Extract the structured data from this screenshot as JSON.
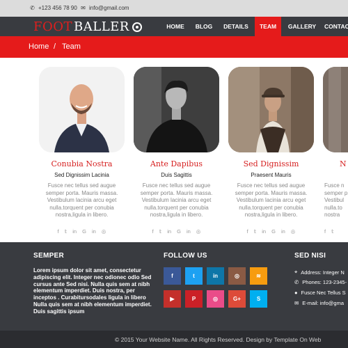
{
  "topbar": {
    "phone_icon": "phone-icon",
    "phone": "+123 456 78 90",
    "email_icon": "envelope-icon",
    "email": "info@gmail.com"
  },
  "logo": {
    "part1": "FOOT",
    "part2": "BALLER",
    "icon": "soccer-ball-icon"
  },
  "nav": {
    "items": [
      "HOME",
      "BLOG",
      "DETAILS",
      "TEAM",
      "GALLERY",
      "CONTACT"
    ],
    "active": "TEAM"
  },
  "breadcrumb": {
    "home": "Home",
    "separator": "/",
    "current": "Team"
  },
  "team": [
    {
      "name": "Conubia Nostra",
      "role": "Sed Dignissim Lacinia",
      "desc": "Fusce nec tellus sed augue semper porta. Mauris massa. Vestibulum lacinia arcu eget nulla.torquent per conubia nostra,ligula in libero."
    },
    {
      "name": "Ante Dapibus",
      "role": "Duis Sagittis",
      "desc": "Fusce nec tellus sed augue semper porta. Mauris massa. Vestibulum lacinia arcu eget nulla.torquent per conubia nostra,ligula in libero."
    },
    {
      "name": "Sed Dignissim",
      "role": "Praesent Mauris",
      "desc": "Fusce nec tellus sed augue semper porta. Mauris massa. Vestibulum lacinia arcu eget nulla.torquent per conubia nostra,ligula in libero."
    },
    {
      "name": "N",
      "role": "",
      "desc": "Fusce n semper p Vestibul nulla.to nostra"
    }
  ],
  "card_socials": [
    "facebook-icon",
    "twitter-icon",
    "linkedin-icon",
    "google-icon",
    "instagram-icon",
    "dribbble-icon"
  ],
  "card_social_glyphs": [
    "f",
    "𝕥",
    "in",
    "G",
    "in",
    "◎"
  ],
  "footer": {
    "col1_title": "SEMPER",
    "col1_text": "Lorem ipsum dolor sit amet, consectetur adipiscing elit. Integer nec odionec odio Sed cursus ante Sed nisi. Nulla quis sem at nibh elementum imperdiet. Duis nostra, per inceptos . Curabitursodales ligula in libero Nulla quis sem at nibh elementum imperdiet. Duis sagittis ipsum",
    "col2_title": "FOLLOW US",
    "social_buttons": [
      {
        "icon": "facebook-icon",
        "glyph": "f",
        "color": "#3b5998"
      },
      {
        "icon": "twitter-icon",
        "glyph": "t",
        "color": "#1da1f2"
      },
      {
        "icon": "linkedin-icon",
        "glyph": "in",
        "color": "#0e76a8"
      },
      {
        "icon": "instagram-icon",
        "glyph": "◎",
        "color": "#8a5a44"
      },
      {
        "icon": "rss-icon",
        "glyph": "≋",
        "color": "#f79c0f"
      },
      {
        "icon": "youtube-icon",
        "glyph": "▶",
        "color": "#c4302b"
      },
      {
        "icon": "pinterest-icon",
        "glyph": "P",
        "color": "#cb2027"
      },
      {
        "icon": "dribbble-icon",
        "glyph": "◎",
        "color": "#ea4c89"
      },
      {
        "icon": "google-plus-icon",
        "glyph": "G+",
        "color": "#dd4b39"
      },
      {
        "icon": "skype-icon",
        "glyph": "S",
        "color": "#00aff0"
      }
    ],
    "col3_title": "SED NISI",
    "address": "Address: Integer N",
    "phones": "Phones: 123-2345-",
    "fusce": "Fusce Nec Tellus S",
    "email": "E-mail: info@gma"
  },
  "copyright": "© 2015 Your Website Name. All Rights Reserved. Design by Template On Web"
}
